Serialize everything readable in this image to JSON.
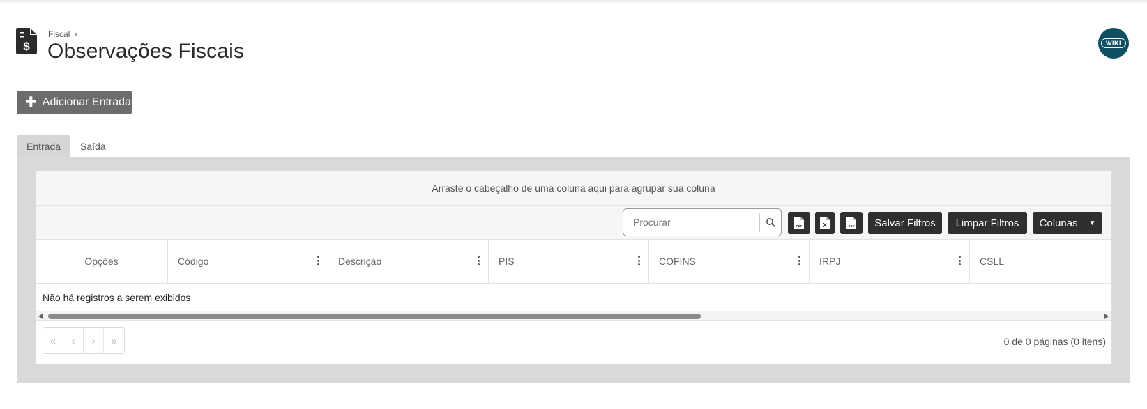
{
  "header": {
    "breadcrumb": "Fiscal",
    "breadcrumb_sep": "›",
    "title": "Observações Fiscais",
    "wiki_label": "WIKI",
    "icon": "fiscal-document-dollar-icon"
  },
  "actions": {
    "add_label": "Adicionar Entrada"
  },
  "tabs": [
    {
      "label": "Entrada",
      "active": true
    },
    {
      "label": "Saída",
      "active": false
    }
  ],
  "grid": {
    "group_hint": "Arraste o cabeçalho de uma coluna aqui para agrupar sua coluna",
    "search_placeholder": "Procurar",
    "toolbar": {
      "pdf_icon": "pdf-export-icon",
      "excel_icon": "excel-export-icon",
      "csv_icon": "csv-export-icon",
      "save_filters": "Salvar Filtros",
      "clear_filters": "Limpar Filtros",
      "columns": "Colunas"
    },
    "columns": [
      "Opções",
      "Código",
      "Descrição",
      "PIS",
      "COFINS",
      "IRPJ",
      "CSLL"
    ],
    "empty_message": "Não há registros a serem exibidos",
    "pager": {
      "first": "«",
      "prev": "‹",
      "next": "›",
      "last": "»",
      "info": "0 de 0 páginas (0 itens)"
    }
  },
  "colors": {
    "wiki_bg": "#0d4f63",
    "add_button_bg": "#6c6c6c",
    "toolbar_button_bg": "#2f2f2f",
    "panel_bg": "#d9d9d9"
  }
}
